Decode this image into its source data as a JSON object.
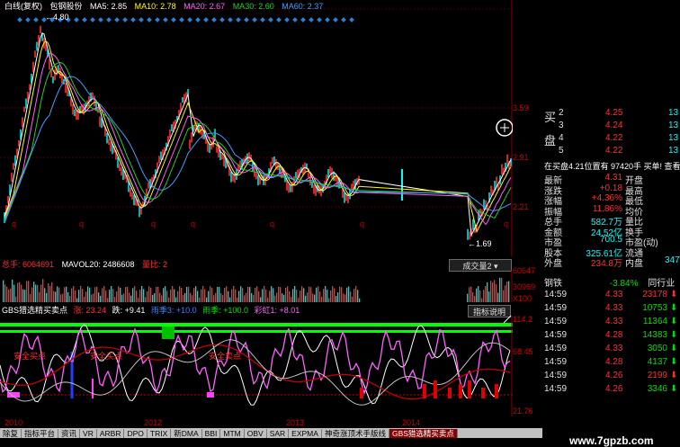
{
  "legend": {
    "prefix": "白线(复权)",
    "name": "包钢股份",
    "ma5": "MA5: 2.85",
    "ma10": "MA10: 2.78",
    "ma20": "MA20: 2.67",
    "ma30": "MA30: 2.60",
    "ma60": "MA60: 2.37"
  },
  "price_axis": {
    "top": "3.59",
    "mid": "2.91",
    "low": "2.21"
  },
  "price_annotations": {
    "high": "4.80",
    "low": "1.69"
  },
  "volume": {
    "total": "总手: 6064691",
    "mavol20": "MAVOL20: 2486608",
    "ratio": "量比: 2",
    "dropdown": "成交量2",
    "axis_top": "60647",
    "axis_mid": "30969",
    "axis_unit": "X100"
  },
  "indicator": {
    "name": "GBS猎选精买卖点",
    "v1": "涨: 23.24",
    "v2": "跌: +9.41",
    "v3": "雨季3: +10.0",
    "v4": "雨季: +100.0",
    "v5": "彩虹1: +8.01",
    "button": "指标说明",
    "axis_top": "114.2",
    "axis_mid": "68.45",
    "axis_low": "21.76",
    "label1": "安全买点",
    "label2": "安全买点",
    "label3": "安全卖点",
    "label4": "卖出"
  },
  "years": [
    "2010",
    "2012",
    "2013",
    "2014"
  ],
  "order_book": {
    "buy_label_1": "买",
    "buy_label_2": "盘",
    "rows": [
      {
        "lv": "2",
        "price": "4.25",
        "vol": "13"
      },
      {
        "lv": "3",
        "price": "4.24",
        "vol": "13"
      },
      {
        "lv": "4",
        "price": "4.22",
        "vol": "13"
      },
      {
        "lv": "5",
        "price": "4.22",
        "vol": "13"
      }
    ],
    "summary": "在买盘4.21位置有  97420手  买单! 查看"
  },
  "stats": [
    {
      "l1": "最新",
      "v1": "4.31",
      "l2": "开盘",
      "v2": ""
    },
    {
      "l1": "涨跌",
      "v1": "+0.18",
      "l2": "最高",
      "v2": ""
    },
    {
      "l1": "涨幅",
      "v1": "+4.36%",
      "l2": "最低",
      "v2": ""
    },
    {
      "l1": "振幅",
      "v1": "11.86%",
      "l2": "均价",
      "v2": ""
    },
    {
      "l1": "总手",
      "v1": "582.7万",
      "l2": "量比",
      "v2": ""
    },
    {
      "l1": "金额",
      "v1": "24.52亿",
      "l2": "换手",
      "v2": ""
    },
    {
      "l1": "市盈",
      "v1": "700.5",
      "l2": "市盈(动)",
      "v2": ""
    },
    {
      "l1": "股本",
      "v1": "325.61亿",
      "l2": "流通",
      "v2": ""
    },
    {
      "l1": "外盘",
      "v1": "234.8万",
      "l2": "内盘",
      "v2": "347"
    }
  ],
  "sector": {
    "name": "钢铁",
    "change": "-3.84%",
    "peer": "同行业"
  },
  "ticks": [
    {
      "t": "14:59",
      "p": "4.33",
      "v": "23178",
      "dir": "down",
      "color": "#ff3030"
    },
    {
      "t": "14:59",
      "p": "4.33",
      "v": "10753",
      "dir": "down",
      "color": "#00e000"
    },
    {
      "t": "14:59",
      "p": "4.33",
      "v": "11364",
      "dir": "down",
      "color": "#00e000"
    },
    {
      "t": "14:59",
      "p": "4.28",
      "v": "14383",
      "dir": "down",
      "color": "#00e000"
    },
    {
      "t": "14:59",
      "p": "4.33",
      "v": "3050",
      "dir": "down",
      "color": "#00e000"
    },
    {
      "t": "14:59",
      "p": "4.28",
      "v": "4137",
      "dir": "down",
      "color": "#00e000"
    },
    {
      "t": "14:59",
      "p": "4.26",
      "v": "2199",
      "dir": "down",
      "color": "#ff3030"
    },
    {
      "t": "14:59",
      "p": "4.26",
      "v": "3346",
      "dir": "down",
      "color": "#00e000"
    }
  ],
  "tabs": [
    "除复",
    "指标平台",
    "资讯",
    "VR",
    "ARBR",
    "DPO",
    "TRIX",
    "新DMA",
    "BBI",
    "MTM",
    "OBV",
    "SAR",
    "EXPMA",
    "神奇涨顶术手版线",
    "GBS猎选精买卖点"
  ],
  "watermark": "www.7gpzb.com",
  "colors": {
    "up": "#ff3030",
    "down": "#00e000",
    "accent": "#ffff00",
    "cyan": "#00ffff"
  }
}
